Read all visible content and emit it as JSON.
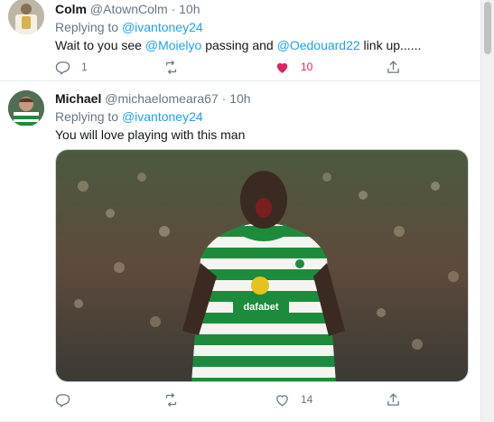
{
  "tweets": [
    {
      "name": "Colm",
      "handle": "@AtownColm",
      "dot": "·",
      "time": "10h",
      "replying_prefix": "Replying to",
      "replying_to": "@ivantoney24",
      "text_parts": {
        "a": "Wait to you see ",
        "m1": "@Moielyo",
        "b": " passing and ",
        "m2": "@Oedouard22",
        "c": " link up......"
      },
      "counts": {
        "reply": "1",
        "retweet": "",
        "like": "10"
      },
      "liked": true
    },
    {
      "name": "Michael",
      "handle": "@michaelomeara67",
      "dot": "·",
      "time": "10h",
      "replying_prefix": "Replying to",
      "replying_to": "@ivantoney24",
      "text": "You will love playing with this man",
      "photo_sponsor": "dafabet",
      "counts": {
        "reply": "",
        "retweet": "",
        "like": "14"
      },
      "liked": false
    }
  ],
  "icons": [
    "reply-icon",
    "retweet-icon",
    "like-icon",
    "share-icon"
  ],
  "colors": {
    "link": "#1da1f2",
    "muted": "#657786",
    "like_active": "#e0245e",
    "divider": "#e6ecf0"
  }
}
